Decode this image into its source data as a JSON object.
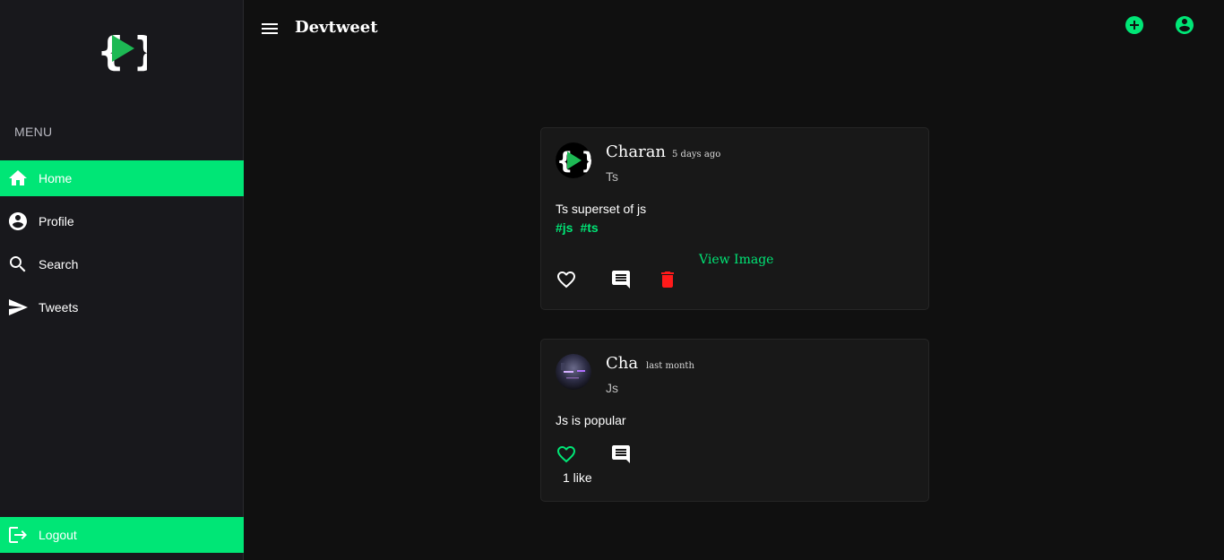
{
  "app": {
    "title": "Devtweet"
  },
  "sidebar": {
    "menu_label": "MENU",
    "items": [
      {
        "label": "Home",
        "icon": "home-icon",
        "active": true
      },
      {
        "label": "Profile",
        "icon": "account-circle-icon",
        "active": false
      },
      {
        "label": "Search",
        "icon": "search-icon",
        "active": false
      },
      {
        "label": "Tweets",
        "icon": "send-icon",
        "active": false
      }
    ],
    "logout_label": "Logout"
  },
  "colors": {
    "accent": "#00e676",
    "danger": "#ff1a1a",
    "background": "#101010",
    "sidebar": "#18181c",
    "card": "#181818"
  },
  "tweets": [
    {
      "author": "Charan",
      "time": "5 days ago",
      "subtitle": "Ts",
      "text": "Ts superset of js",
      "tags": [
        "#js",
        "#ts"
      ],
      "view_image_label": "View Image",
      "liked": false,
      "likes_label": ""
    },
    {
      "author": "Cha",
      "time": "last month",
      "subtitle": "Js",
      "text": "Js is popular",
      "tags": [],
      "liked": true,
      "likes_label": "1 like"
    }
  ]
}
